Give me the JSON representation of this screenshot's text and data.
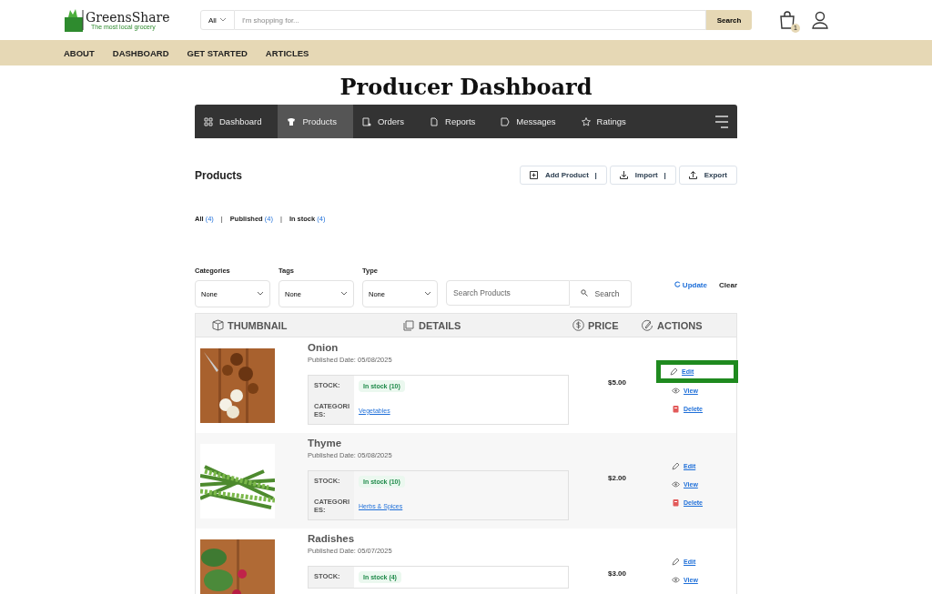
{
  "header": {
    "logo_name": "GreensShare",
    "logo_tagline": "The most local grocery",
    "search_scope": "All",
    "search_placeholder": "I'm shopping for...",
    "search_button": "Search",
    "cart_count": "1"
  },
  "nav": [
    "ABOUT",
    "DASHBOARD",
    "GET STARTED",
    "ARTICLES"
  ],
  "page_title": "Producer Dashboard",
  "tabs": [
    {
      "kind": "dashboard",
      "label": "Dashboard",
      "selected": false
    },
    {
      "kind": "products",
      "label": "Products",
      "selected": true
    },
    {
      "kind": "orders",
      "label": "Orders",
      "selected": false
    },
    {
      "kind": "reports",
      "label": "Reports",
      "selected": false
    },
    {
      "kind": "messages",
      "label": "Messages",
      "selected": false
    },
    {
      "kind": "ratings",
      "label": "Ratings",
      "selected": false
    }
  ],
  "section_title": "Products",
  "toolbar_buttons": [
    {
      "kind": "add",
      "label": "Add Product",
      "separator": "|"
    },
    {
      "kind": "import",
      "label": "Import",
      "separator": "|"
    },
    {
      "kind": "export",
      "label": "Export"
    }
  ],
  "status_filters": [
    {
      "label": "All",
      "count": "(4)"
    },
    {
      "label": "Published",
      "count": "(4)"
    },
    {
      "label": "In stock",
      "count": "(4)"
    }
  ],
  "filter_separator": "|",
  "filters": [
    {
      "label": "Categories",
      "value": "None"
    },
    {
      "label": "Tags",
      "value": "None"
    },
    {
      "label": "Type",
      "value": "None"
    }
  ],
  "product_search": {
    "placeholder": "Search Products",
    "button": "Search"
  },
  "update_link": "Update",
  "clear_link": "Clear",
  "table": {
    "columns": [
      {
        "kind": "thumbnail",
        "label": "THUMBNAIL"
      },
      {
        "kind": "details",
        "label": "DETAILS"
      },
      {
        "kind": "price",
        "label": "PRICE"
      },
      {
        "kind": "actions",
        "label": "ACTIONS"
      }
    ],
    "rows": [
      {
        "name": "Onion",
        "published": "Published Date: 05/08/2025",
        "stock_label": "STOCK:",
        "stock": "In stock (10)",
        "categories_label": "CATEGORI ES:",
        "category": "Vegetables",
        "price": "$5.00",
        "actions": [
          {
            "kind": "edit",
            "label": "Edit",
            "highlighted": true
          },
          {
            "kind": "view",
            "label": "View",
            "highlighted": false
          },
          {
            "kind": "delete",
            "label": "Delete",
            "highlighted": false
          }
        ]
      },
      {
        "name": "Thyme",
        "published": "Published Date: 05/08/2025",
        "stock_label": "STOCK:",
        "stock": "In stock (10)",
        "categories_label": "CATEGORI ES:",
        "category": "Herbs & Spices",
        "price": "$2.00",
        "actions": [
          {
            "kind": "edit",
            "label": "Edit",
            "highlighted": false
          },
          {
            "kind": "view",
            "label": "View",
            "highlighted": false
          },
          {
            "kind": "delete",
            "label": "Delete",
            "highlighted": false
          }
        ]
      },
      {
        "name": "Radishes",
        "published": "Published Date: 05/07/2025",
        "stock_label": "STOCK:",
        "stock": "In stock (4)",
        "price": "$3.00",
        "actions": [
          {
            "kind": "edit",
            "label": "Edit",
            "highlighted": false
          },
          {
            "kind": "view",
            "label": "View",
            "highlighted": false
          }
        ]
      }
    ]
  }
}
